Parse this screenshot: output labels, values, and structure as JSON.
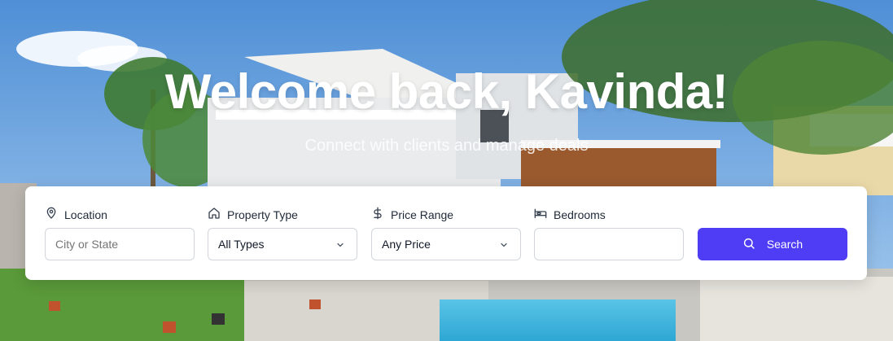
{
  "hero": {
    "title": "Welcome back, Kavinda!",
    "subtitle": "Connect with clients and manage deals"
  },
  "search": {
    "location": {
      "label": "Location",
      "placeholder": "City or State",
      "icon": "map-pin-icon"
    },
    "property_type": {
      "label": "Property Type",
      "value": "All Types",
      "icon": "home-icon"
    },
    "price_range": {
      "label": "Price Range",
      "value": "Any Price",
      "icon": "dollar-icon"
    },
    "bedrooms": {
      "label": "Bedrooms",
      "value": "",
      "icon": "bed-icon"
    },
    "button_label": "Search",
    "button_icon": "search-icon",
    "accent_color": "#4f3cf5"
  }
}
